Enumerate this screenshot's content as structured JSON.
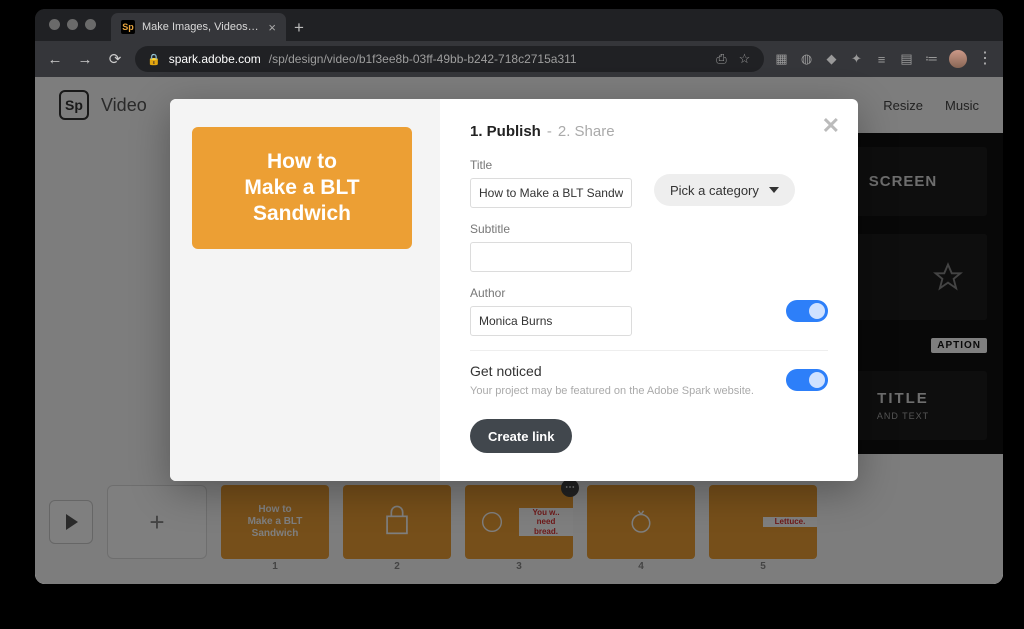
{
  "browser": {
    "tab_title": "Make Images, Videos and Web S",
    "tab_favicon": "Sp",
    "url_domain": "spark.adobe.com",
    "url_path": "/sp/design/video/b1f3ee8b-03ff-49bb-b242-718c2715a311"
  },
  "app": {
    "logo_text": "Sp",
    "title": "Video",
    "menu": {
      "resize": "Resize",
      "music": "Music"
    }
  },
  "right_pane": {
    "card_fullscreen": "SCREEN",
    "card_caption": "APTION",
    "card_title_text": "TITLE",
    "card_title_sub": "AND TEXT"
  },
  "timeline": {
    "slides": [
      {
        "num": "1",
        "text": "How to\nMake a BLT\nSandwich",
        "type": "full"
      },
      {
        "num": "2",
        "text": "",
        "type": "icon"
      },
      {
        "num": "3",
        "left_text": "",
        "right_text": "You w..\nneed\nbread.",
        "type": "split",
        "menu": true
      },
      {
        "num": "4",
        "text": "",
        "type": "icon"
      },
      {
        "num": "5",
        "left_text": "",
        "right_text": "Lettuce.",
        "type": "split"
      }
    ]
  },
  "modal": {
    "preview_text": "How to\nMake a BLT\nSandwich",
    "step1": "1. Publish",
    "step_sep": " - ",
    "step2": "2. Share",
    "title_label": "Title",
    "title_value": "How to Make a BLT Sandwich",
    "subtitle_label": "Subtitle",
    "subtitle_value": "",
    "author_label": "Author",
    "author_value": "Monica Burns",
    "category_label": "Pick a category",
    "get_noticed_h": "Get noticed",
    "get_noticed_hint": "Your project may be featured on the Adobe Spark website.",
    "create_link": "Create link"
  }
}
